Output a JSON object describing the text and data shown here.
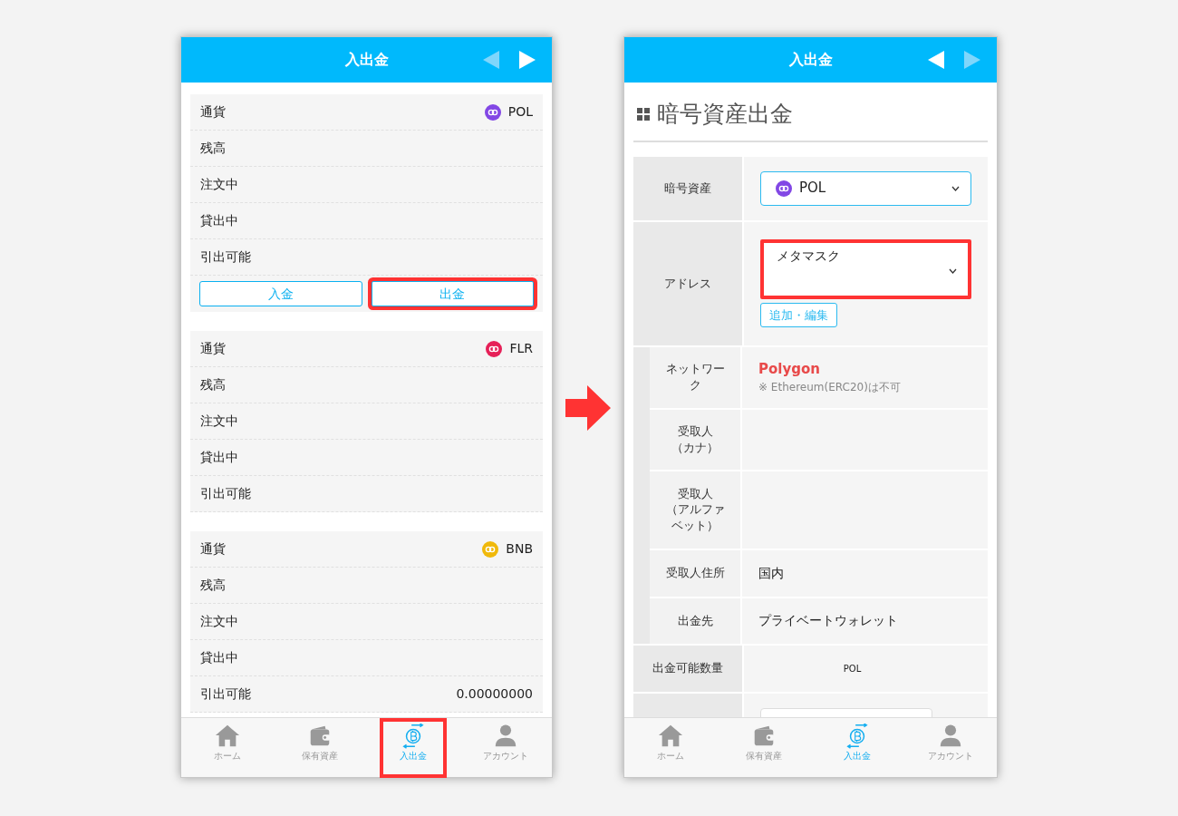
{
  "balance_screen": {
    "header": {
      "title": "入出金",
      "back_enabled": false,
      "forward_enabled": true
    },
    "cards": [
      {
        "currency_label": "通貨",
        "currency": "POL",
        "color": "#8247e5",
        "rows": [
          {
            "label": "残高"
          },
          {
            "label": "注文中"
          },
          {
            "label": "貸出中"
          },
          {
            "label": "引出可能"
          }
        ],
        "buttons": [
          {
            "label": "入金",
            "highlighted": false
          },
          {
            "label": "出金",
            "highlighted": true
          }
        ]
      },
      {
        "currency_label": "通貨",
        "currency": "FLR",
        "color": "#e62058",
        "rows": [
          {
            "label": "残高"
          },
          {
            "label": "注文中"
          },
          {
            "label": "貸出中"
          },
          {
            "label": "引出可能"
          }
        ]
      },
      {
        "currency_label": "通貨",
        "currency": "BNB",
        "color": "#f0b90b",
        "rows": [
          {
            "label": "残高"
          },
          {
            "label": "注文中"
          },
          {
            "label": "貸出中"
          },
          {
            "label": "引出可能",
            "value": "0.00000000"
          }
        ]
      }
    ],
    "tab_bar": [
      {
        "label": "ホーム",
        "selected": false,
        "highlighted": false
      },
      {
        "label": "保有資産",
        "selected": false,
        "highlighted": false
      },
      {
        "label": "入出金",
        "selected": true,
        "highlighted": true
      },
      {
        "label": "アカウント",
        "selected": false,
        "highlighted": false
      }
    ]
  },
  "withdraw_screen": {
    "header": {
      "title": "入出金",
      "back_enabled": true,
      "forward_enabled": false
    },
    "page_title": "暗号資産出金",
    "form": [
      {
        "kind": "select",
        "label": "暗号資産",
        "value": "POL",
        "color": "#8247e5",
        "highlighted": false
      },
      {
        "kind": "address",
        "label": "アドレス",
        "value": "メタマスク",
        "button": "追加・編集",
        "highlighted": true,
        "details": [
          {
            "kind": "network",
            "label_lines": [
              "ネットワー",
              "ク"
            ],
            "value": "Polygon",
            "note": "※ Ethereum(ERC20)は不可"
          },
          {
            "kind": "text",
            "label_lines": [
              "受取人",
              "（カナ）"
            ]
          },
          {
            "kind": "text",
            "label_lines": [
              "受取人",
              "（アルファ",
              "ベット）"
            ]
          },
          {
            "kind": "text",
            "label_lines": [
              "受取人住所"
            ],
            "value": "国内"
          },
          {
            "kind": "text",
            "label_lines": [
              "出金先"
            ],
            "value": "プライベートウォレット"
          }
        ]
      },
      {
        "kind": "amount",
        "label": "出金可能数量",
        "value": "POL"
      },
      {
        "kind": "input"
      }
    ],
    "tab_bar": [
      {
        "label": "ホーム",
        "selected": false,
        "highlighted": false
      },
      {
        "label": "保有資産",
        "selected": false,
        "highlighted": false
      },
      {
        "label": "入出金",
        "selected": true,
        "highlighted": false
      },
      {
        "label": "アカウント",
        "selected": false,
        "highlighted": false
      }
    ]
  }
}
